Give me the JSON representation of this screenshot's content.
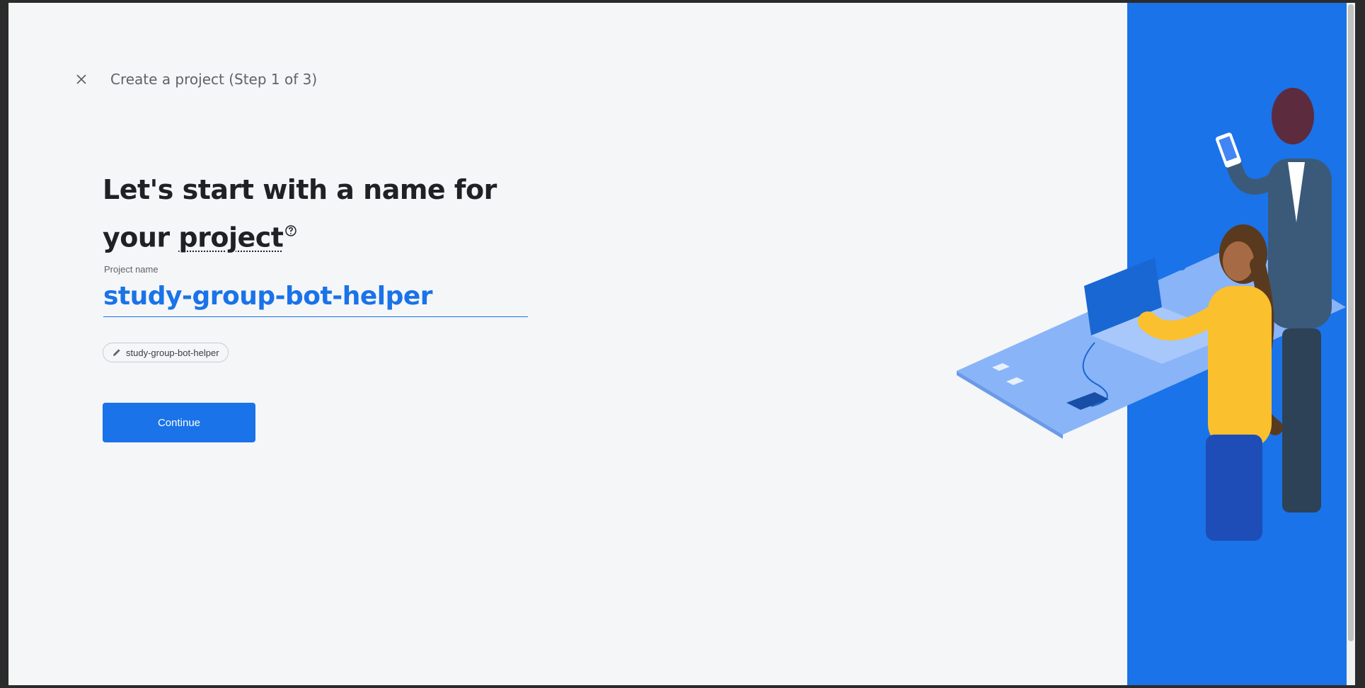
{
  "header": {
    "step_title": "Create a project (Step 1 of 3)"
  },
  "main": {
    "heading_line1": "Let's start with a name for",
    "heading_line2_prefix": "your",
    "heading_project_word": "project",
    "field": {
      "label": "Project name",
      "value": "study-group-bot-helper"
    },
    "project_id_chip": "study-group-bot-helper",
    "continue_label": "Continue"
  },
  "colors": {
    "accent": "#1a73e8",
    "background": "#f4f6f8",
    "text": "#202124"
  },
  "icons": [
    "close-icon",
    "help-icon",
    "pencil-icon"
  ]
}
